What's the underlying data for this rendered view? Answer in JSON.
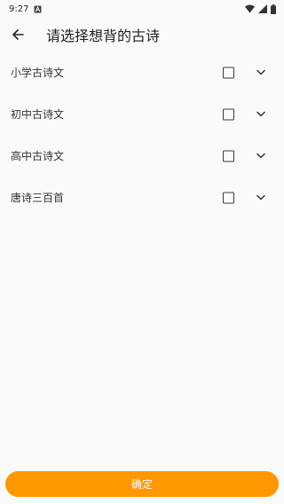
{
  "status_bar": {
    "time": "9:27",
    "icons": [
      "notification-a-icon",
      "wifi-icon",
      "cell-signal-icon",
      "battery-icon"
    ]
  },
  "app_bar": {
    "back_icon": "arrow-back-icon",
    "title": "请选择想背的古诗"
  },
  "options": [
    {
      "label": "小学古诗文",
      "checked": false,
      "expand_icon": "chevron-down-icon"
    },
    {
      "label": "初中古诗文",
      "checked": false,
      "expand_icon": "chevron-down-icon"
    },
    {
      "label": "高中古诗文",
      "checked": false,
      "expand_icon": "chevron-down-icon"
    },
    {
      "label": "唐诗三百首",
      "checked": false,
      "expand_icon": "chevron-down-icon"
    }
  ],
  "confirm_button": {
    "label": "确定",
    "color": "#ff9800"
  },
  "colors": {
    "background": "#fafafa",
    "accent": "#ff9800",
    "text": "#222222"
  }
}
